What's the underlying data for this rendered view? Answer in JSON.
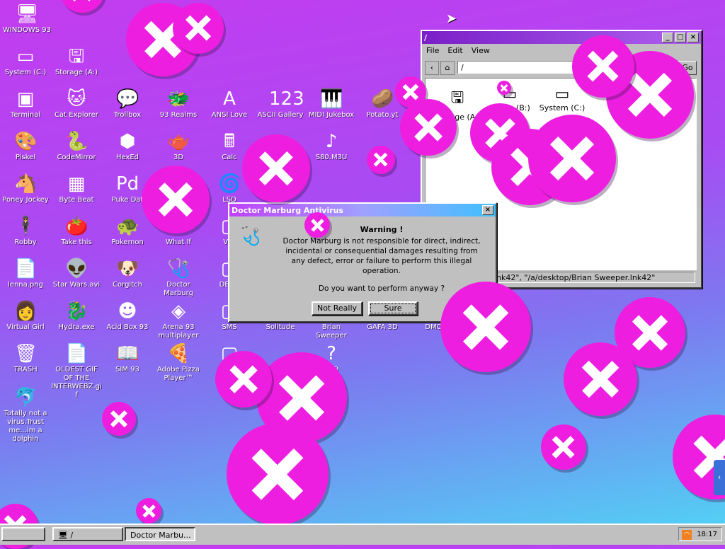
{
  "desktop_icons": [
    {
      "label": "WINDOWS 93",
      "glyph": "🖥"
    },
    {
      "label": "System (C:)",
      "glyph": "▭"
    },
    {
      "label": "Storage (A:)",
      "glyph": "🖫"
    },
    {
      "label": "Terminal",
      "glyph": "▣"
    },
    {
      "label": "Cat Explorer",
      "glyph": "🐱"
    },
    {
      "label": "Trollbox",
      "glyph": "💬"
    },
    {
      "label": "93 Realms",
      "glyph": "🐲"
    },
    {
      "label": "ANSI Love",
      "glyph": "A"
    },
    {
      "label": "ASCII Gallery",
      "glyph": "123"
    },
    {
      "label": "MIDI Jukebox",
      "glyph": "🎹"
    },
    {
      "label": "Potato.yt",
      "glyph": "🥔"
    },
    {
      "label": "Piskel",
      "glyph": "🎨"
    },
    {
      "label": "CodeMirror",
      "glyph": "🐍"
    },
    {
      "label": "HexEd",
      "glyph": "⬢"
    },
    {
      "label": "3D",
      "glyph": "🫖"
    },
    {
      "label": "Calc",
      "glyph": "🖩"
    },
    {
      "label": "S80.M3U",
      "glyph": "♪"
    },
    {
      "label": "Poney Jockey",
      "glyph": "🐴"
    },
    {
      "label": "Byte Beat",
      "glyph": "▦"
    },
    {
      "label": "Puke Dat",
      "glyph": "Pd"
    },
    {
      "label": "LSD",
      "glyph": "🌀"
    },
    {
      "label": "Robby",
      "glyph": "🕴"
    },
    {
      "label": "Take this",
      "glyph": "🍅"
    },
    {
      "label": "Pokemon",
      "glyph": "🐢"
    },
    {
      "label": "What If",
      "glyph": "?"
    },
    {
      "label": "Virt",
      "glyph": "▢"
    },
    {
      "label": "lenna.png",
      "glyph": "📄"
    },
    {
      "label": "Star Wars.avi",
      "glyph": "👽"
    },
    {
      "label": "Corgitch",
      "glyph": "🐶"
    },
    {
      "label": "Doctor Marburg",
      "glyph": "🩺"
    },
    {
      "label": "DERG",
      "glyph": "▢"
    },
    {
      "label": "Virtual Girl",
      "glyph": "👩"
    },
    {
      "label": "Hydra.exe",
      "glyph": "🐉"
    },
    {
      "label": "Acid Box 93",
      "glyph": "☻"
    },
    {
      "label": "Arena 93 multiplayer",
      "glyph": "◈"
    },
    {
      "label": "SMS",
      "glyph": "▢"
    },
    {
      "label": "Solitude",
      "glyph": "▢"
    },
    {
      "label": "Brian Sweeper",
      "glyph": "▢"
    },
    {
      "label": "GAFA 3D",
      "glyph": "▢"
    },
    {
      "label": "DMC",
      "glyph": "▢"
    },
    {
      "label": "TRASH",
      "glyph": "🗑"
    },
    {
      "label": "OLDEST GIF OF THE INTERWEBZ.gif",
      "glyph": "📄"
    },
    {
      "label": "SIM 93",
      "glyph": "📖"
    },
    {
      "label": "Adobe Pizza Player™",
      "glyph": "🍕"
    },
    {
      "label": "C",
      "glyph": "▢"
    },
    {
      "label": "STO",
      "glyph": "?"
    },
    {
      "label": "Totally not a virus.Trust me...im a dolphin",
      "glyph": "🐬"
    }
  ],
  "explorer": {
    "title": "/",
    "menu": [
      "File",
      "Edit",
      "View"
    ],
    "address": "/",
    "go_label": "Go",
    "items": [
      "Storage (A:)",
      "Profile (B:)",
      "System (C:)"
    ],
    "status": "nk42\", \"/a/desktop/Brian Sweeper.lnk42\""
  },
  "dialog": {
    "title": "Doctor Marburg Antivirus",
    "heading": "Warning !",
    "body": "Doctor Marburg is not responsible for direct, indirect, incidental or consequential damages resulting from any defect, error or failure to perform this illegal operation.",
    "question": "Do you want to perform anyway ?",
    "btn_no": "Not Really",
    "btn_yes": "Sure"
  },
  "taskbar": {
    "tasks": [
      "/",
      "Doctor Marbu..."
    ],
    "clock": "18:17"
  },
  "colors": {
    "accent": "#ee1ee0",
    "title_active": "#8a2be2",
    "title_dialog": "#c040ff"
  }
}
